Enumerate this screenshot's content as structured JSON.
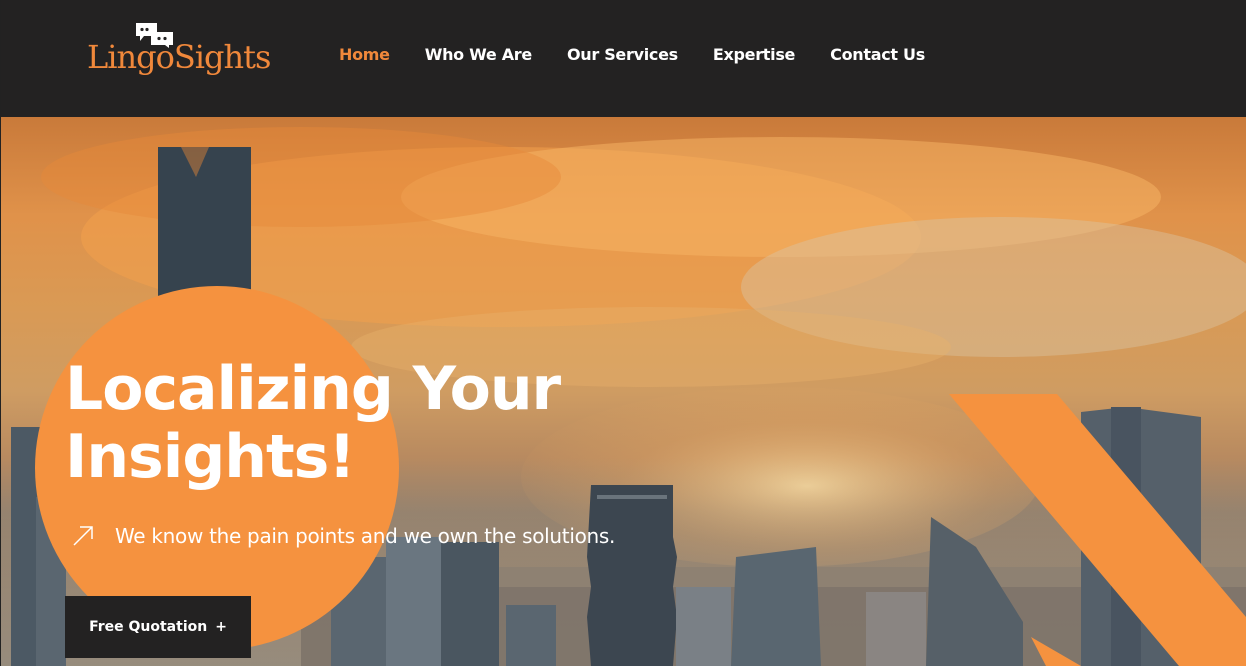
{
  "brand": {
    "logo_text": "LingoSights"
  },
  "nav": {
    "items": [
      {
        "label": "Home",
        "active": true
      },
      {
        "label": "Who We Are",
        "active": false
      },
      {
        "label": "Our Services",
        "active": false
      },
      {
        "label": "Expertise",
        "active": false
      },
      {
        "label": "Contact Us",
        "active": false
      }
    ]
  },
  "hero": {
    "headline_line1": "Localizing Your",
    "headline_line2": "Insights!",
    "tagline": "We know the pain points and we own the solutions.",
    "cta_label": "Free Quotation",
    "cta_icon": "+"
  },
  "colors": {
    "accent": "#f0883b",
    "header_bg": "#232222",
    "text_light": "#ffffff"
  }
}
